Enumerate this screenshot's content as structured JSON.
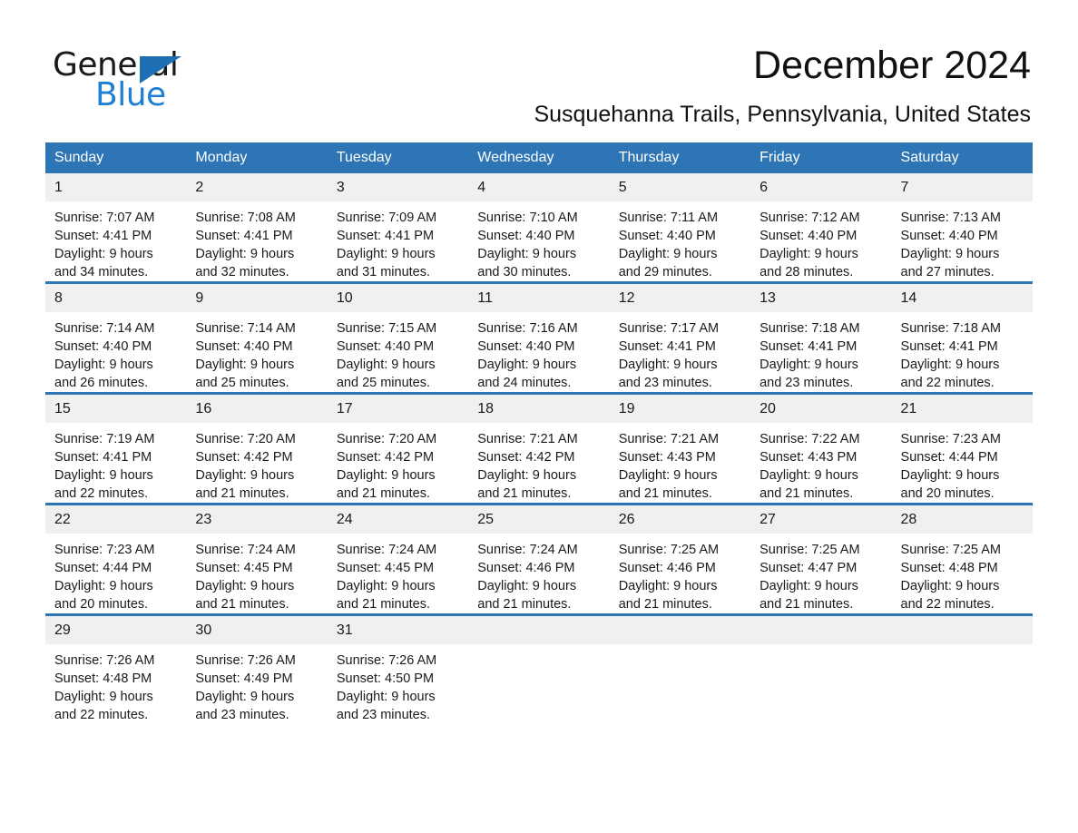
{
  "brand": {
    "name_part1": "General",
    "name_part2": "Blue",
    "accent_color": "#1F7FD4",
    "triangle_color": "#1F6FB5"
  },
  "header": {
    "month_title": "December 2024",
    "location": "Susquehanna Trails, Pennsylvania, United States"
  },
  "theme": {
    "header_blue": "#2E75B6",
    "daynum_band": "#F0F0F0",
    "cell_background": "#FFFFFF",
    "text_color": "#1A1A1A"
  },
  "weekday_headers": [
    "Sunday",
    "Monday",
    "Tuesday",
    "Wednesday",
    "Thursday",
    "Friday",
    "Saturday"
  ],
  "weeks": [
    [
      {
        "day": "1",
        "sunrise": "Sunrise: 7:07 AM",
        "sunset": "Sunset: 4:41 PM",
        "daylight_line1": "Daylight: 9 hours",
        "daylight_line2": "and 34 minutes."
      },
      {
        "day": "2",
        "sunrise": "Sunrise: 7:08 AM",
        "sunset": "Sunset: 4:41 PM",
        "daylight_line1": "Daylight: 9 hours",
        "daylight_line2": "and 32 minutes."
      },
      {
        "day": "3",
        "sunrise": "Sunrise: 7:09 AM",
        "sunset": "Sunset: 4:41 PM",
        "daylight_line1": "Daylight: 9 hours",
        "daylight_line2": "and 31 minutes."
      },
      {
        "day": "4",
        "sunrise": "Sunrise: 7:10 AM",
        "sunset": "Sunset: 4:40 PM",
        "daylight_line1": "Daylight: 9 hours",
        "daylight_line2": "and 30 minutes."
      },
      {
        "day": "5",
        "sunrise": "Sunrise: 7:11 AM",
        "sunset": "Sunset: 4:40 PM",
        "daylight_line1": "Daylight: 9 hours",
        "daylight_line2": "and 29 minutes."
      },
      {
        "day": "6",
        "sunrise": "Sunrise: 7:12 AM",
        "sunset": "Sunset: 4:40 PM",
        "daylight_line1": "Daylight: 9 hours",
        "daylight_line2": "and 28 minutes."
      },
      {
        "day": "7",
        "sunrise": "Sunrise: 7:13 AM",
        "sunset": "Sunset: 4:40 PM",
        "daylight_line1": "Daylight: 9 hours",
        "daylight_line2": "and 27 minutes."
      }
    ],
    [
      {
        "day": "8",
        "sunrise": "Sunrise: 7:14 AM",
        "sunset": "Sunset: 4:40 PM",
        "daylight_line1": "Daylight: 9 hours",
        "daylight_line2": "and 26 minutes."
      },
      {
        "day": "9",
        "sunrise": "Sunrise: 7:14 AM",
        "sunset": "Sunset: 4:40 PM",
        "daylight_line1": "Daylight: 9 hours",
        "daylight_line2": "and 25 minutes."
      },
      {
        "day": "10",
        "sunrise": "Sunrise: 7:15 AM",
        "sunset": "Sunset: 4:40 PM",
        "daylight_line1": "Daylight: 9 hours",
        "daylight_line2": "and 25 minutes."
      },
      {
        "day": "11",
        "sunrise": "Sunrise: 7:16 AM",
        "sunset": "Sunset: 4:40 PM",
        "daylight_line1": "Daylight: 9 hours",
        "daylight_line2": "and 24 minutes."
      },
      {
        "day": "12",
        "sunrise": "Sunrise: 7:17 AM",
        "sunset": "Sunset: 4:41 PM",
        "daylight_line1": "Daylight: 9 hours",
        "daylight_line2": "and 23 minutes."
      },
      {
        "day": "13",
        "sunrise": "Sunrise: 7:18 AM",
        "sunset": "Sunset: 4:41 PM",
        "daylight_line1": "Daylight: 9 hours",
        "daylight_line2": "and 23 minutes."
      },
      {
        "day": "14",
        "sunrise": "Sunrise: 7:18 AM",
        "sunset": "Sunset: 4:41 PM",
        "daylight_line1": "Daylight: 9 hours",
        "daylight_line2": "and 22 minutes."
      }
    ],
    [
      {
        "day": "15",
        "sunrise": "Sunrise: 7:19 AM",
        "sunset": "Sunset: 4:41 PM",
        "daylight_line1": "Daylight: 9 hours",
        "daylight_line2": "and 22 minutes."
      },
      {
        "day": "16",
        "sunrise": "Sunrise: 7:20 AM",
        "sunset": "Sunset: 4:42 PM",
        "daylight_line1": "Daylight: 9 hours",
        "daylight_line2": "and 21 minutes."
      },
      {
        "day": "17",
        "sunrise": "Sunrise: 7:20 AM",
        "sunset": "Sunset: 4:42 PM",
        "daylight_line1": "Daylight: 9 hours",
        "daylight_line2": "and 21 minutes."
      },
      {
        "day": "18",
        "sunrise": "Sunrise: 7:21 AM",
        "sunset": "Sunset: 4:42 PM",
        "daylight_line1": "Daylight: 9 hours",
        "daylight_line2": "and 21 minutes."
      },
      {
        "day": "19",
        "sunrise": "Sunrise: 7:21 AM",
        "sunset": "Sunset: 4:43 PM",
        "daylight_line1": "Daylight: 9 hours",
        "daylight_line2": "and 21 minutes."
      },
      {
        "day": "20",
        "sunrise": "Sunrise: 7:22 AM",
        "sunset": "Sunset: 4:43 PM",
        "daylight_line1": "Daylight: 9 hours",
        "daylight_line2": "and 21 minutes."
      },
      {
        "day": "21",
        "sunrise": "Sunrise: 7:23 AM",
        "sunset": "Sunset: 4:44 PM",
        "daylight_line1": "Daylight: 9 hours",
        "daylight_line2": "and 20 minutes."
      }
    ],
    [
      {
        "day": "22",
        "sunrise": "Sunrise: 7:23 AM",
        "sunset": "Sunset: 4:44 PM",
        "daylight_line1": "Daylight: 9 hours",
        "daylight_line2": "and 20 minutes."
      },
      {
        "day": "23",
        "sunrise": "Sunrise: 7:24 AM",
        "sunset": "Sunset: 4:45 PM",
        "daylight_line1": "Daylight: 9 hours",
        "daylight_line2": "and 21 minutes."
      },
      {
        "day": "24",
        "sunrise": "Sunrise: 7:24 AM",
        "sunset": "Sunset: 4:45 PM",
        "daylight_line1": "Daylight: 9 hours",
        "daylight_line2": "and 21 minutes."
      },
      {
        "day": "25",
        "sunrise": "Sunrise: 7:24 AM",
        "sunset": "Sunset: 4:46 PM",
        "daylight_line1": "Daylight: 9 hours",
        "daylight_line2": "and 21 minutes."
      },
      {
        "day": "26",
        "sunrise": "Sunrise: 7:25 AM",
        "sunset": "Sunset: 4:46 PM",
        "daylight_line1": "Daylight: 9 hours",
        "daylight_line2": "and 21 minutes."
      },
      {
        "day": "27",
        "sunrise": "Sunrise: 7:25 AM",
        "sunset": "Sunset: 4:47 PM",
        "daylight_line1": "Daylight: 9 hours",
        "daylight_line2": "and 21 minutes."
      },
      {
        "day": "28",
        "sunrise": "Sunrise: 7:25 AM",
        "sunset": "Sunset: 4:48 PM",
        "daylight_line1": "Daylight: 9 hours",
        "daylight_line2": "and 22 minutes."
      }
    ],
    [
      {
        "day": "29",
        "sunrise": "Sunrise: 7:26 AM",
        "sunset": "Sunset: 4:48 PM",
        "daylight_line1": "Daylight: 9 hours",
        "daylight_line2": "and 22 minutes."
      },
      {
        "day": "30",
        "sunrise": "Sunrise: 7:26 AM",
        "sunset": "Sunset: 4:49 PM",
        "daylight_line1": "Daylight: 9 hours",
        "daylight_line2": "and 23 minutes."
      },
      {
        "day": "31",
        "sunrise": "Sunrise: 7:26 AM",
        "sunset": "Sunset: 4:50 PM",
        "daylight_line1": "Daylight: 9 hours",
        "daylight_line2": "and 23 minutes."
      },
      {
        "day": "",
        "sunrise": "",
        "sunset": "",
        "daylight_line1": "",
        "daylight_line2": ""
      },
      {
        "day": "",
        "sunrise": "",
        "sunset": "",
        "daylight_line1": "",
        "daylight_line2": ""
      },
      {
        "day": "",
        "sunrise": "",
        "sunset": "",
        "daylight_line1": "",
        "daylight_line2": ""
      },
      {
        "day": "",
        "sunrise": "",
        "sunset": "",
        "daylight_line1": "",
        "daylight_line2": ""
      }
    ]
  ]
}
